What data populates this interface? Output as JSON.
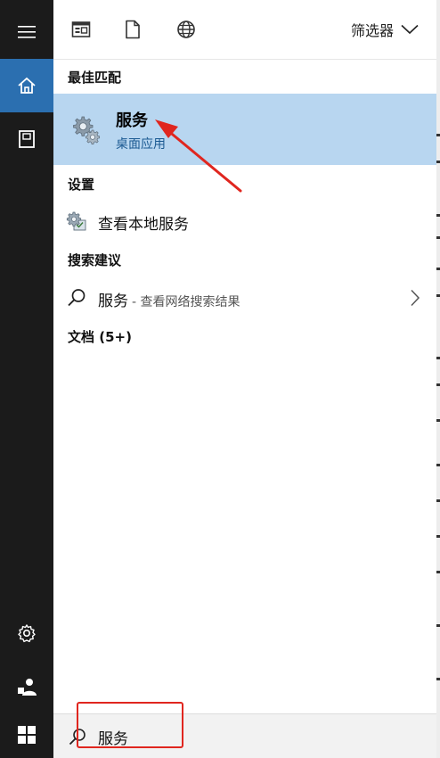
{
  "rail": {
    "items": [
      {
        "name": "home",
        "active": true
      },
      {
        "name": "documents"
      },
      {
        "name": "settings"
      },
      {
        "name": "user"
      },
      {
        "name": "start"
      }
    ]
  },
  "topbar": {
    "filter_label": "筛选器"
  },
  "sections": {
    "best_match": "最佳匹配",
    "settings": "设置",
    "search_suggestions": "搜索建议",
    "documents": "文档 (5+)"
  },
  "best_match": {
    "name": "服务",
    "subtitle": "桌面应用"
  },
  "settings_item": {
    "label": "查看本地服务"
  },
  "suggestion": {
    "label": "服务",
    "suffix": "- 查看网络搜索结果"
  },
  "search": {
    "value": "服务"
  },
  "colors": {
    "accent": "#2b6fb0",
    "highlight": "#b8d6f0",
    "annotation": "#e0261f"
  }
}
